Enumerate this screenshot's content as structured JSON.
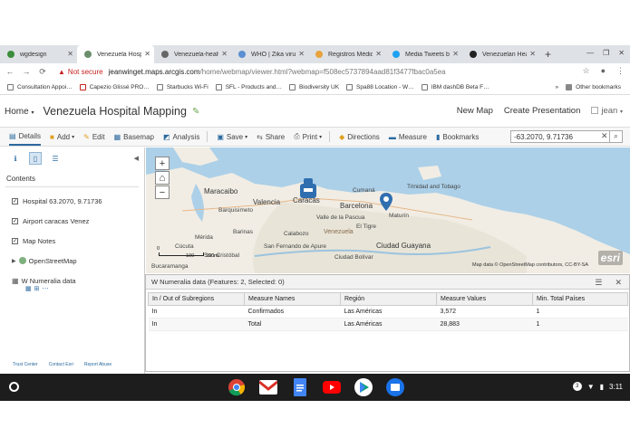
{
  "browser": {
    "tabs": [
      {
        "title": "wgdesign",
        "active": false,
        "favicon_color": "#3c8d3c"
      },
      {
        "title": "Venezuela Hospit…",
        "active": true,
        "favicon_color": "#6a8f6a"
      },
      {
        "title": "Venezuela-health…",
        "active": false,
        "favicon_color": "#666666"
      },
      {
        "title": "WHO | Zika virus…",
        "active": false,
        "favicon_color": "#5b8fd1"
      },
      {
        "title": "Registros Médico…",
        "active": false,
        "favicon_color": "#e8a33c"
      },
      {
        "title": "Media Tweets by…",
        "active": false,
        "favicon_color": "#1da1f2"
      },
      {
        "title": "Venezuelan Healt…",
        "active": false,
        "favicon_color": "#222222"
      }
    ],
    "new_tab_symbol": "+",
    "address": {
      "security_label": "Not secure",
      "url_host": "jeanwinget.maps.arcgis.com",
      "url_path": "/home/webmap/viewer.html?webmap=f508ec5737894aad81f3477fbac0a5ea"
    },
    "bookmarks": [
      "Consultation Appoi…",
      "Capezio Glissé PRO…",
      "Starbucks Wi-Fi",
      "SFL - Products and…",
      "Biodiversity UK",
      "Spa88 Location - W…",
      "IBM dashDB Beta F…"
    ],
    "other_bookmarks": "Other bookmarks"
  },
  "app": {
    "home_label": "Home",
    "map_title": "Venezuela Hospital Mapping",
    "header_links": {
      "new_map": "New Map",
      "create_presentation": "Create Presentation",
      "user": "jean"
    }
  },
  "toolbar": {
    "details": "Details",
    "add": "Add",
    "edit": "Edit",
    "basemap": "Basemap",
    "analysis": "Analysis",
    "save": "Save",
    "share": "Share",
    "print": "Print",
    "directions": "Directions",
    "measure": "Measure",
    "bookmarks": "Bookmarks",
    "search_value": "-63.2070, 9.71736"
  },
  "left_panel": {
    "contents_label": "Contents",
    "layers": [
      {
        "name": "Hospital 63.2070, 9.71736",
        "checked": true
      },
      {
        "name": "Airport caracas Venez",
        "checked": true
      },
      {
        "name": "Map Notes",
        "checked": true
      },
      {
        "name": "OpenStreetMap",
        "checked": false
      },
      {
        "name": "W Numeralia data",
        "checked": false
      }
    ],
    "footer_links": [
      "Trust Center",
      "Contact Esri",
      "Report Abuse"
    ]
  },
  "map": {
    "labels": {
      "maracaibo": "Maracaibo",
      "valencia": "Valencia",
      "barquisimeto": "Barquisimeto",
      "caracas": "Caracas",
      "barcelona": "Barcelona",
      "cumana": "Cumaná",
      "trinidad": "Trinidad and Tobago",
      "venezuela": "Venezuela",
      "ciudad_guayana": "Ciudad Guayana",
      "el_tigre": "El Tigre",
      "maturin": "Maturín",
      "calabozo": "Calabozo",
      "barinas": "Barinas",
      "merida": "Mérida",
      "cucuta": "Cúcuta",
      "bucaramanga": "Bucaramanga",
      "san_cristobal": "San Cristóbal",
      "ciudad_bolivar": "Ciudad Bolívar",
      "valle": "Valle de la Pascua",
      "san_fernando": "San Fernando de Apure"
    },
    "scale_labels": [
      "0",
      "100",
      "200mi"
    ],
    "attribution": "Map data © OpenStreetMap contributors, CC-BY-SA",
    "esri_logo": "esri"
  },
  "attribute_table": {
    "title": "W Numeralia data (Features: 2, Selected: 0)",
    "columns": [
      "In / Out of Subregions",
      "Measure Names",
      "Región",
      "Measure Values",
      "Min. Total Países"
    ],
    "rows": [
      [
        "In",
        "Confirmados",
        "Las Américas",
        "3,572",
        "1"
      ],
      [
        "In",
        "Total",
        "Las Américas",
        "28,883",
        "1"
      ]
    ]
  },
  "shelf": {
    "apps": [
      "chrome",
      "gmail",
      "docs",
      "youtube",
      "play-store",
      "files"
    ],
    "notification_count": "3",
    "time": "3:11"
  }
}
